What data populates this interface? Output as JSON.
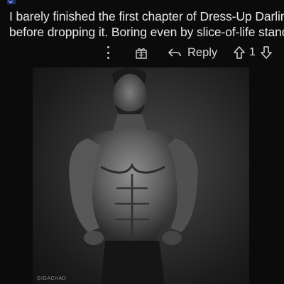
{
  "comment": {
    "line1": "I barely finished the first chapter of Dress-Up Darling",
    "line2": "before dropping it. Boring even by slice-of-life standards."
  },
  "actions": {
    "more_icon": "vertical-ellipsis-icon",
    "award_icon": "gift-award-icon",
    "reply_icon": "reply-arrow-icon",
    "reply_label": "Reply",
    "upvote_icon": "arrow-up-icon",
    "vote_count": "1",
    "downvote_icon": "arrow-down-icon"
  },
  "image": {
    "subject": "muscular-man-photo",
    "watermark": "GIGACHAD"
  },
  "colors": {
    "background": "#0b0b0b",
    "text": "#e8e8e8",
    "icon": "#cfcfcf"
  }
}
